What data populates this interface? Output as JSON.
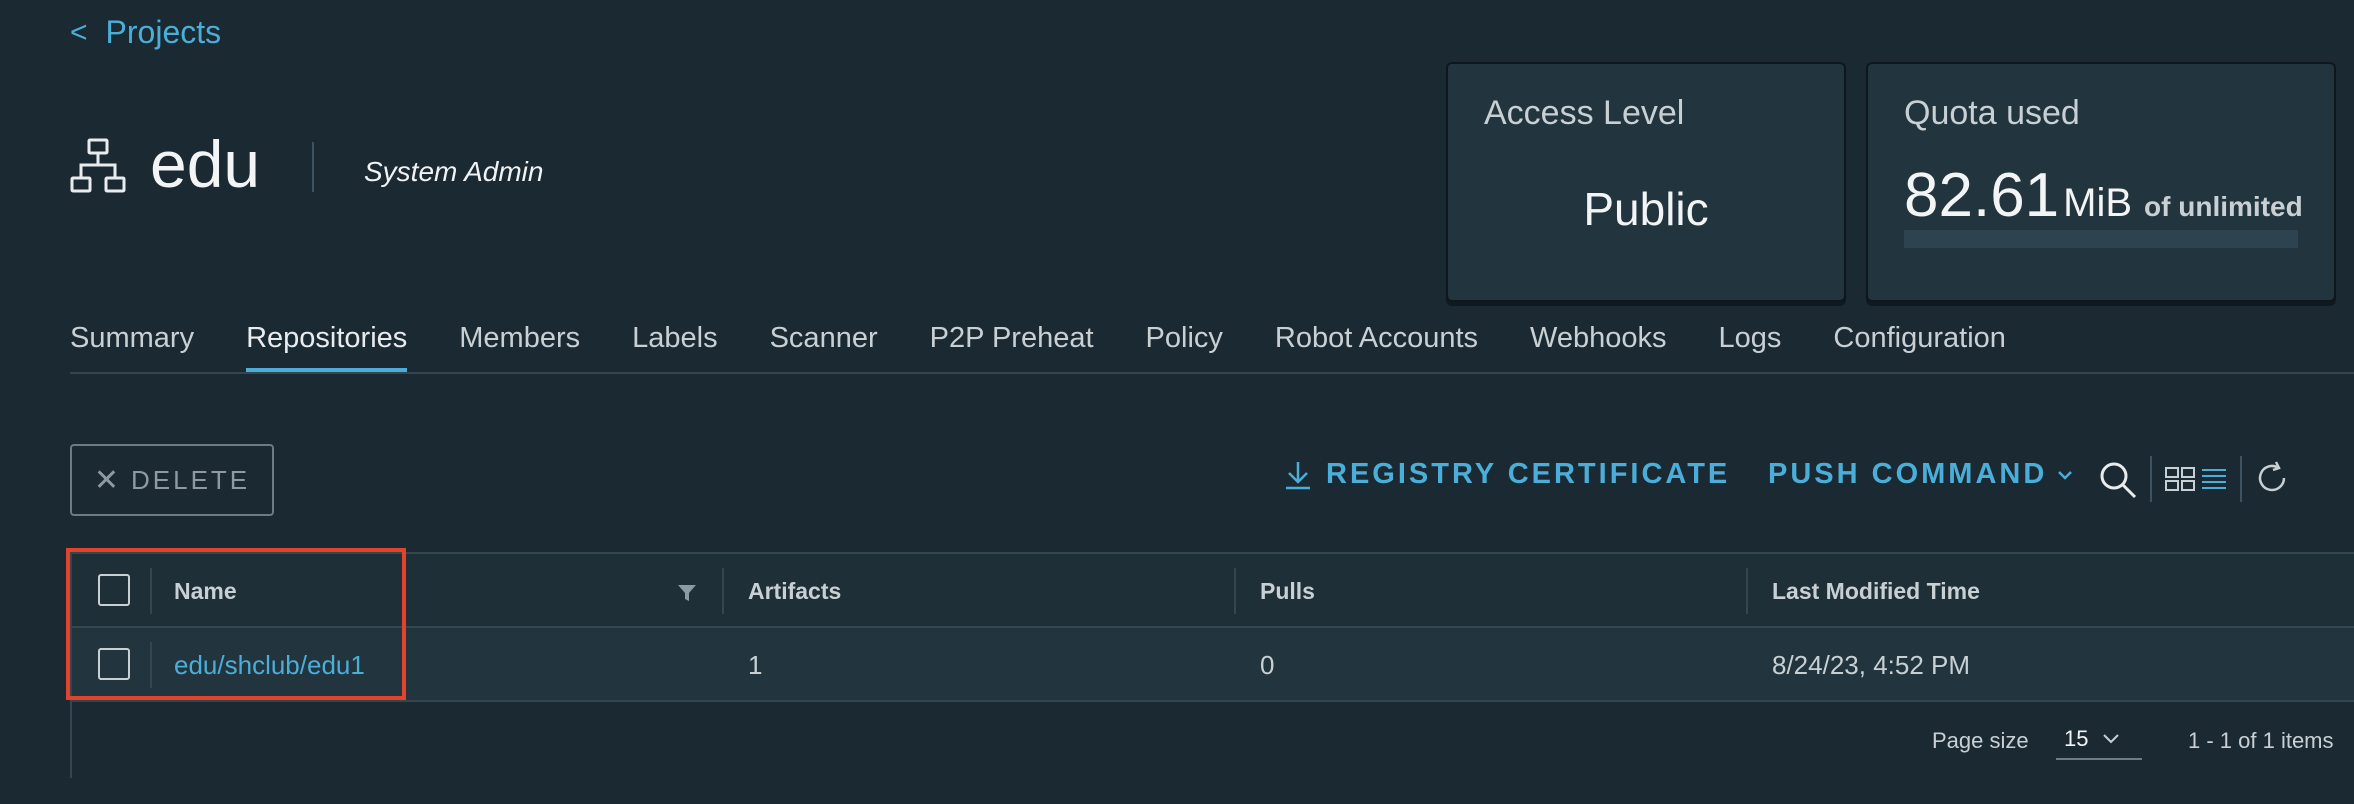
{
  "breadcrumb": {
    "back_icon": "chevron-left-icon",
    "label": "Projects"
  },
  "project": {
    "icon": "project-tree-icon",
    "name": "edu",
    "role": "System Admin"
  },
  "access_card": {
    "title": "Access Level",
    "value": "Public"
  },
  "quota_card": {
    "title": "Quota used",
    "value": "82.61",
    "unit": "MiB",
    "of_text": "of unlimited",
    "used_fraction": 0
  },
  "tabs": [
    {
      "label": "Summary",
      "active": false
    },
    {
      "label": "Repositories",
      "active": true
    },
    {
      "label": "Members",
      "active": false
    },
    {
      "label": "Labels",
      "active": false
    },
    {
      "label": "Scanner",
      "active": false
    },
    {
      "label": "P2P Preheat",
      "active": false
    },
    {
      "label": "Policy",
      "active": false
    },
    {
      "label": "Robot Accounts",
      "active": false
    },
    {
      "label": "Webhooks",
      "active": false
    },
    {
      "label": "Logs",
      "active": false
    },
    {
      "label": "Configuration",
      "active": false
    }
  ],
  "toolbar": {
    "delete_label": "DELETE",
    "registry_cert_label": "REGISTRY CERTIFICATE",
    "push_command_label": "PUSH COMMAND"
  },
  "table": {
    "columns": [
      "Name",
      "Artifacts",
      "Pulls",
      "Last Modified Time"
    ],
    "rows": [
      {
        "name": "edu/shclub/edu1",
        "artifacts": "1",
        "pulls": "0",
        "last_modified": "8/24/23, 4:52 PM"
      }
    ],
    "footer": {
      "page_size_label": "Page size",
      "page_size": "15",
      "pager_info": "1 - 1 of 1 items"
    }
  },
  "colors": {
    "accent": "#4aaed9",
    "background": "#1b2a32",
    "highlight": "#e2432a"
  }
}
